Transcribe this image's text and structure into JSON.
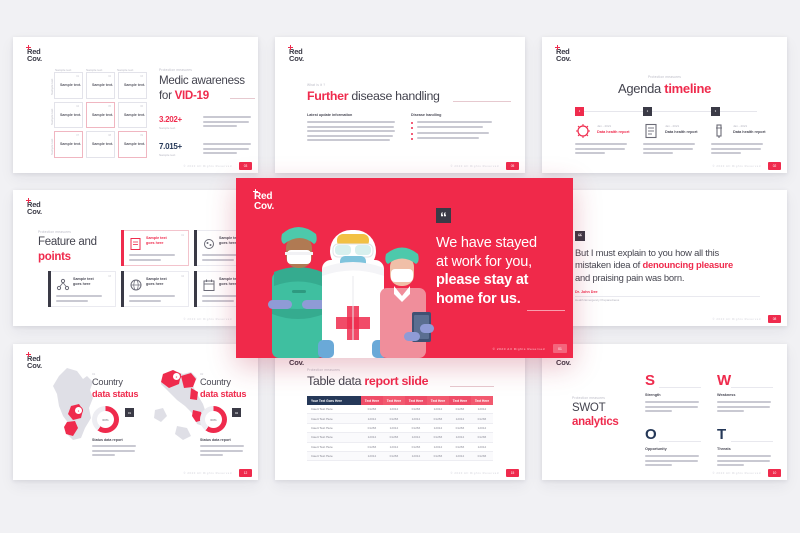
{
  "brand": {
    "logo_line1": "Red",
    "logo_line2": "Cov.",
    "accent_red": "#ef2b4d",
    "hero_red": "#f0294a",
    "navy": "#253858",
    "dark": "#3a3a46",
    "background": "#f1f1f4"
  },
  "common": {
    "footer": "© 2020 All Rights Reserved",
    "kicker": "Protection measures",
    "body_placeholder": "But I must explain to you how all this mistaken idea of denouncing pleasure and praising."
  },
  "slides": {
    "medic": {
      "page_number": "03",
      "kicker": "Protection measures",
      "title_plain": "Medic awareness",
      "title_line2_plain": "for ",
      "title_line2_red": "VID-19",
      "col_heads": [
        "Sample text",
        "Sample text",
        "Sample text"
      ],
      "row_heads": [
        "Sample text",
        "Sample text",
        "Sample text"
      ],
      "cells": [
        {
          "label": "Sample text.",
          "num": "01",
          "highlight": false
        },
        {
          "label": "Sample text.",
          "num": "02",
          "highlight": false
        },
        {
          "label": "Sample text.",
          "num": "03",
          "highlight": false
        },
        {
          "label": "Sample text.",
          "num": "04",
          "highlight": false
        },
        {
          "label": "Sample text.",
          "num": "05",
          "highlight": true
        },
        {
          "label": "Sample text.",
          "num": "06",
          "highlight": false
        },
        {
          "label": "Sample text.",
          "num": "07",
          "highlight": true
        },
        {
          "label": "Sample text.",
          "num": "08",
          "highlight": false
        },
        {
          "label": "Sample text.",
          "num": "09",
          "highlight": true
        }
      ],
      "stats": [
        {
          "value": "3.202+",
          "label": "Sample text",
          "color": "red",
          "desc": "But I must explain to you how all this mistaken idea of denouncing pleasure and praising."
        },
        {
          "value": "7.015+",
          "label": "Sample text",
          "color": "navy",
          "desc": "But I must explain to you how all this mistaken idea of denouncing pleasure and praising."
        }
      ]
    },
    "disease": {
      "page_number": "05",
      "kicker": "What is it ?",
      "title_red": "Further",
      "title_plain": " disease handling",
      "left_heading": "Latest update information",
      "left_body": "But I must explain to you how all this mistaken idea of denouncing pleasure and praising pain was born and I will give you a complete account of the system, and expound the actual teachings of the great explorer of the new system that we make idea of denouncing pleasure and praising.",
      "right_heading": "Disease handling",
      "bullets": [
        "But I must explain to you how all this virus disease",
        "Complete account of the system, and expound",
        "Mistaken idea of denouncing pleasure and praising",
        "Pain was born and I will give you a complete"
      ]
    },
    "agenda": {
      "page_number": "02",
      "kicker": "Protection measures",
      "title_plain": "Agenda ",
      "title_red": "timeline",
      "items": [
        {
          "step": "1",
          "date": "Jan - 2021",
          "heading": "Data health report",
          "active": true,
          "icon": "virus-icon",
          "desc": "But I must explain to you and how is of all this mistaken idea of denouncing our."
        },
        {
          "step": "2",
          "date": "Jan - 2021",
          "heading": "Data health report",
          "active": false,
          "icon": "document-icon",
          "desc": "But I must explain to you and how is of all this mistaken idea of denouncing our."
        },
        {
          "step": "3",
          "date": "Jan - 2021",
          "heading": "Data health report",
          "active": false,
          "icon": "vaccine-icon",
          "desc": "But I must explain to you and how is of all this mistaken idea of denouncing our."
        }
      ]
    },
    "features": {
      "page_number": "07",
      "kicker": "Protection measures",
      "title_plain": "Feature and",
      "title_red": "points",
      "cards": [
        {
          "num": "01",
          "icon": "report-icon",
          "title_l1": "Sample text",
          "title_l2": "goes here",
          "desc": "But I must explain to you and how is of all this.",
          "highlight": true
        },
        {
          "num": "02",
          "icon": "virus-cell-icon",
          "title_l1": "Sample text",
          "title_l2": "goes here",
          "desc": "But I must explain to you and how is of all this.",
          "highlight": false
        },
        {
          "num": "03",
          "icon": "molecule-icon",
          "title_l1": "Sample text",
          "title_l2": "goes here",
          "desc": "But I must explain to you and how is of all this.",
          "highlight": false
        },
        {
          "num": "04",
          "icon": "globe-virus-icon",
          "title_l1": "Sample text",
          "title_l2": "goes here",
          "desc": "But I must explain to you and how is of all this.",
          "highlight": false
        },
        {
          "num": "05",
          "icon": "calendar-icon",
          "title_l1": "Sample text",
          "title_l2": "goes here",
          "desc": "But I must explain to you and how is of all this.",
          "highlight": false
        }
      ]
    },
    "hero": {
      "page_number": "01",
      "quote_mark": "“",
      "line1": "We have stayed",
      "line2": "at work for you,",
      "line3": "please stay at",
      "line4": "home for us.",
      "illustration": "three-medical-workers-illustration",
      "footer": "© 2020 All Rights Reserved"
    },
    "quote": {
      "page_number": "08",
      "quote_mark": "“",
      "line1": "But I must explain to you how all this",
      "line2_plain": "mistaken idea of ",
      "line2_red": "denouncing pleasure",
      "line3": "and praising pain was born.",
      "author": "Dr. John Dee",
      "role": "Health Emergency Preparedness"
    },
    "country": {
      "page_number": "12",
      "panels": [
        {
          "map": "finland-map",
          "num": "01",
          "title_plain": "Country",
          "title_red": "data status",
          "percent": "60%",
          "pin": "1",
          "badge": "01",
          "sub": "Status data report",
          "desc": "But I must explain to you how all this mistaken idea of denouncing."
        },
        {
          "map": "italy-map",
          "num": "02",
          "title_plain": "Country",
          "title_red": "data status",
          "percent": "60%",
          "pin": "2",
          "badge": "02",
          "sub": "Status data report",
          "desc": "But I must explain to you how all this mistaken idea of denouncing."
        }
      ]
    },
    "table": {
      "page_number": "15",
      "kicker": "Protection measures",
      "title_plain": "Table data ",
      "title_red": "report slide",
      "headers": [
        "Your Text Goes Here",
        "Text Here",
        "Text Here",
        "Text Here",
        "Text Here",
        "Text Here",
        "Text Here"
      ],
      "rows": [
        [
          "Insert Text Here",
          "01283",
          "12012",
          "01283",
          "12012",
          "01283",
          "12012"
        ],
        [
          "Insert Text Here",
          "12012",
          "01283",
          "12012",
          "01283",
          "12012",
          "01283"
        ],
        [
          "Insert Text Here",
          "01283",
          "12012",
          "01283",
          "12012",
          "01283",
          "12012"
        ],
        [
          "Insert Text Here",
          "12012",
          "01283",
          "12012",
          "01283",
          "12012",
          "01283"
        ],
        [
          "Insert Text Here",
          "01283",
          "12012",
          "01283",
          "12012",
          "01283",
          "12012"
        ],
        [
          "Insert Text Here",
          "12012",
          "01283",
          "12012",
          "01283",
          "12012",
          "01283"
        ]
      ]
    },
    "swot": {
      "page_number": "10",
      "kicker": "Protection measures",
      "title_plain": "SWOT",
      "title_red": "analytics",
      "items": [
        {
          "letter": "S",
          "name": "Strength",
          "color": "red",
          "desc": "But I must explain to you how all this mistaken idea of denouncing."
        },
        {
          "letter": "W",
          "name": "Weakness",
          "color": "red",
          "desc": "But I must explain to you how all this mistaken idea of denouncing."
        },
        {
          "letter": "O",
          "name": "Opportunity",
          "color": "navy",
          "desc": "But I must explain to you how all this mistaken idea of denouncing."
        },
        {
          "letter": "T",
          "name": "Threats",
          "color": "navy",
          "desc": "But I must explain to you how all this mistaken idea of denouncing."
        }
      ]
    }
  }
}
